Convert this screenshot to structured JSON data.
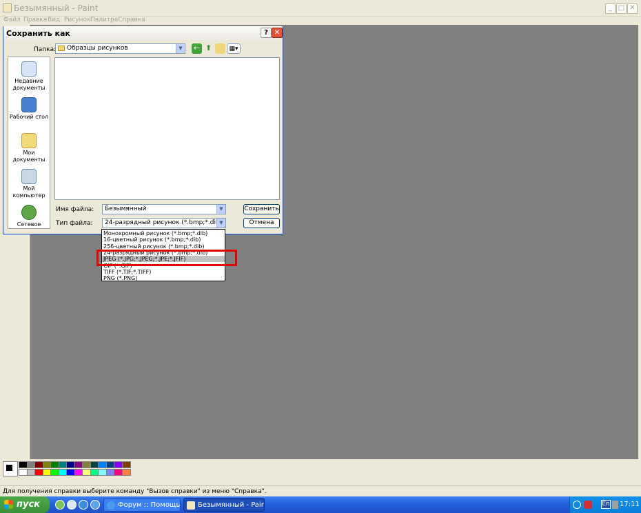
{
  "window": {
    "title": "Безымянный - Paint"
  },
  "menu": [
    "Файл",
    "Правка",
    "Вид",
    "Рисунок",
    "Палитра",
    "Справка"
  ],
  "dialog": {
    "title": "Сохранить как",
    "help_label": "?",
    "close_label": "✕",
    "folder_label": "Папка:",
    "folder_value": "Образцы рисунков",
    "places": [
      "Недавние документы",
      "Рабочий стол",
      "Мои документы",
      "Мой компьютер",
      "Сетевое"
    ],
    "filename_label": "Имя файла:",
    "filename_value": "Безымянный",
    "filetype_label": "Тип файла:",
    "filetype_value": "24-разрядный рисунок (*.bmp;*.dib)",
    "save_label": "Сохранить",
    "cancel_label": "Отмена",
    "filetype_options": [
      "Монохромный рисунок (*.bmp;*.dib)",
      "16-цветный рисунок (*.bmp;*.dib)",
      "256-цветный рисунок (*.bmp;*.dib)",
      "24-разрядный рисунок (*.bmp;*.dib)",
      "JPEG (*.JPG;*.JPEG;*.JPE;*.JFIF)",
      "GIF (*.GIF)",
      "TIFF (*.TIF;*.TIFF)",
      "PNG (*.PNG)"
    ],
    "selected_option_index": 4
  },
  "palette": {
    "top_row": [
      "#000000",
      "#808080",
      "#800000",
      "#808000",
      "#008000",
      "#008080",
      "#000080",
      "#800080",
      "#808040",
      "#004040",
      "#0080ff",
      "#004080",
      "#8000ff",
      "#804000"
    ],
    "bottom_row": [
      "#ffffff",
      "#c0c0c0",
      "#ff0000",
      "#ffff00",
      "#00ff00",
      "#00ffff",
      "#0000ff",
      "#ff00ff",
      "#ffff80",
      "#00ff80",
      "#80ffff",
      "#8080ff",
      "#ff0080",
      "#ff8040"
    ]
  },
  "status": {
    "text": "Для получения справки выберите команду \"Вызов справки\" из меню \"Справка\"."
  },
  "taskbar": {
    "start_label": "пуск",
    "tasks": [
      "Форум :: Помощь :: ...",
      "Безымянный - Paint"
    ],
    "language": "En",
    "clock": "17:11"
  }
}
